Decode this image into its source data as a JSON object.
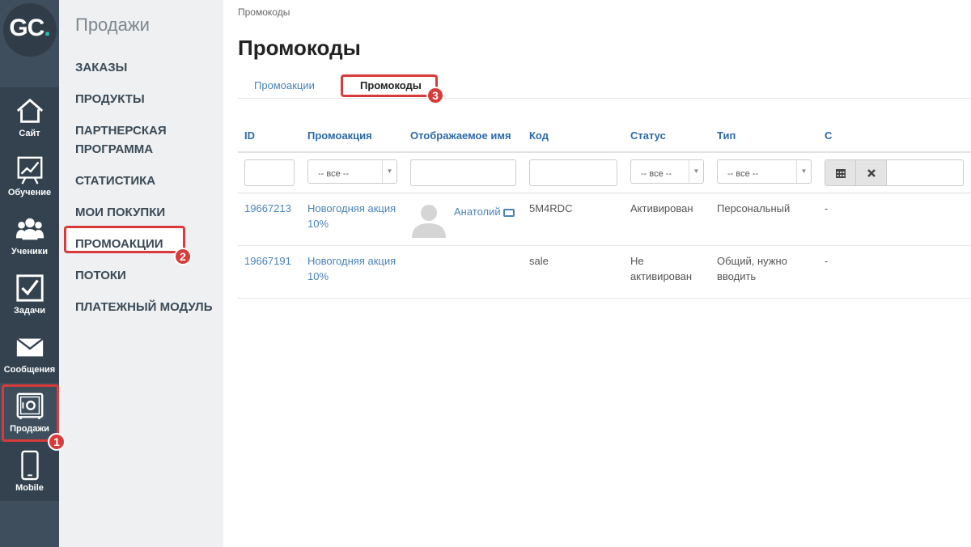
{
  "logo": {
    "text": "GC",
    "dot": "."
  },
  "iconbar": {
    "items": [
      {
        "label": "Сайт",
        "icon": "home-icon"
      },
      {
        "label": "Обучение",
        "icon": "chart-board-icon"
      },
      {
        "label": "Ученики",
        "icon": "users-icon"
      },
      {
        "label": "Задачи",
        "icon": "checkbox-icon"
      },
      {
        "label": "Сообщения",
        "icon": "envelope-icon"
      },
      {
        "label": "Продажи",
        "icon": "safe-icon",
        "active": true
      },
      {
        "label": "Mobile",
        "icon": "phone-icon"
      }
    ]
  },
  "submenu": {
    "title": "Продажи",
    "items": [
      {
        "label": "ЗАКАЗЫ"
      },
      {
        "label": "ПРОДУКТЫ"
      },
      {
        "label": "ПАРТНЕРСКАЯ ПРОГРАММА"
      },
      {
        "label": "СТАТИСТИКА"
      },
      {
        "label": "МОИ ПОКУПКИ"
      },
      {
        "label": "ПРОМОАКЦИИ",
        "active": true
      },
      {
        "label": "ПОТОКИ"
      },
      {
        "label": "ПЛАТЕЖНЫЙ МОДУЛЬ"
      }
    ]
  },
  "badges": {
    "one": "1",
    "two": "2",
    "three": "3"
  },
  "main": {
    "breadcrumb": "Промокоды",
    "title": "Промокоды",
    "tabs": [
      {
        "label": "Промоакции"
      },
      {
        "label": "Промокоды",
        "active": true
      }
    ]
  },
  "table": {
    "headers": [
      "ID",
      "Промоакция",
      "Отображаемое имя",
      "Код",
      "Статус",
      "Тип",
      "С"
    ],
    "filter_select_label": "-- все --",
    "rows": [
      {
        "id": "19667213",
        "promo": "Новогодняя акция 10%",
        "user": "Анатолий",
        "code": "5M4RDC",
        "status": "Активирован",
        "type": "Персональный",
        "from": "-"
      },
      {
        "id": "19667191",
        "promo": "Новогодняя акция 10%",
        "user": "",
        "code": "sale",
        "status": "Не активирован",
        "type": "Общий, нужно вводить",
        "from": "-"
      }
    ]
  },
  "colors": {
    "accent_red": "#d93a3a",
    "link_blue": "#4a83b8",
    "sidebar_dark": "#3e4e5c"
  }
}
